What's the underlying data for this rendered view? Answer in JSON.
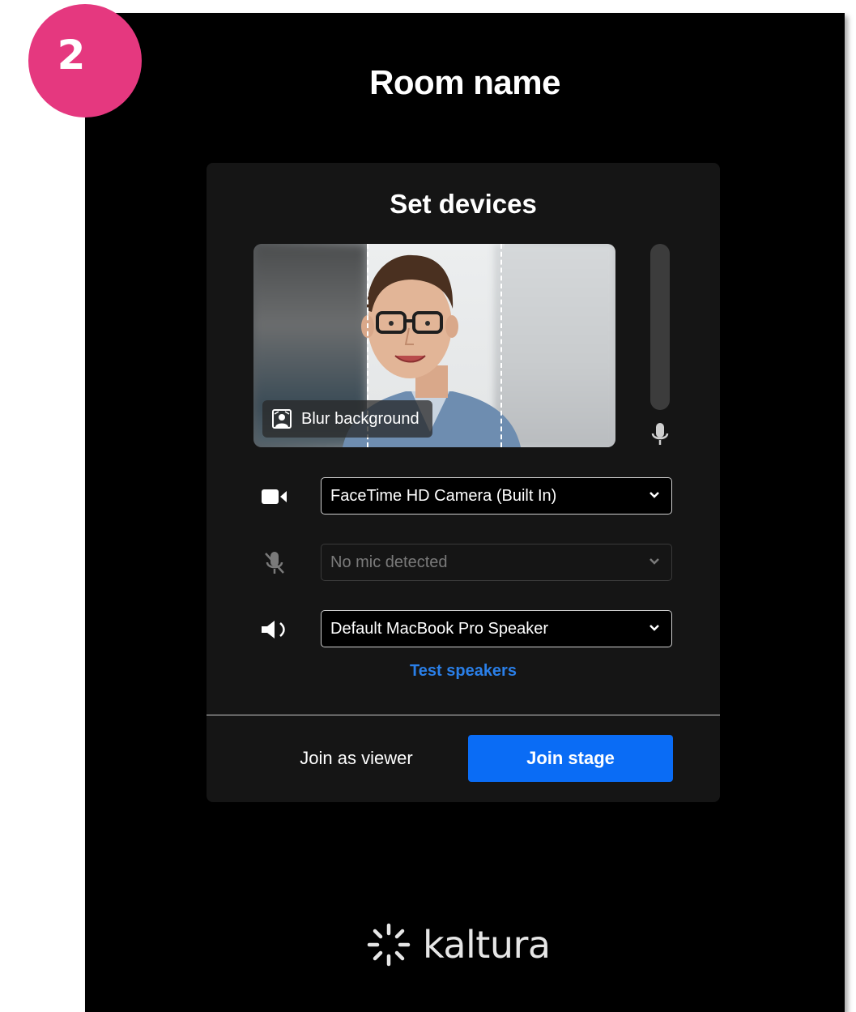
{
  "step_badge": "2",
  "room": {
    "title": "Room name"
  },
  "devices_panel": {
    "title": "Set devices",
    "blur_background_label": "Blur background",
    "camera": {
      "icon": "video-camera-icon",
      "selected": "FaceTime HD Camera (Built In)"
    },
    "microphone": {
      "icon": "mic-off-icon",
      "selected": "No mic detected",
      "disabled": true
    },
    "speaker": {
      "icon": "speaker-icon",
      "selected": "Default MacBook Pro Speaker"
    },
    "test_speakers_label": "Test speakers",
    "mic_level_icon": "microphone-icon"
  },
  "actions": {
    "join_viewer_label": "Join as viewer",
    "join_stage_label": "Join stage"
  },
  "brand": {
    "wordmark": "kaltura"
  },
  "colors": {
    "badge": "#e5387f",
    "accent": "#0a6cf5",
    "link": "#2a7fe8",
    "background": "#000000",
    "panel": "#151515"
  }
}
